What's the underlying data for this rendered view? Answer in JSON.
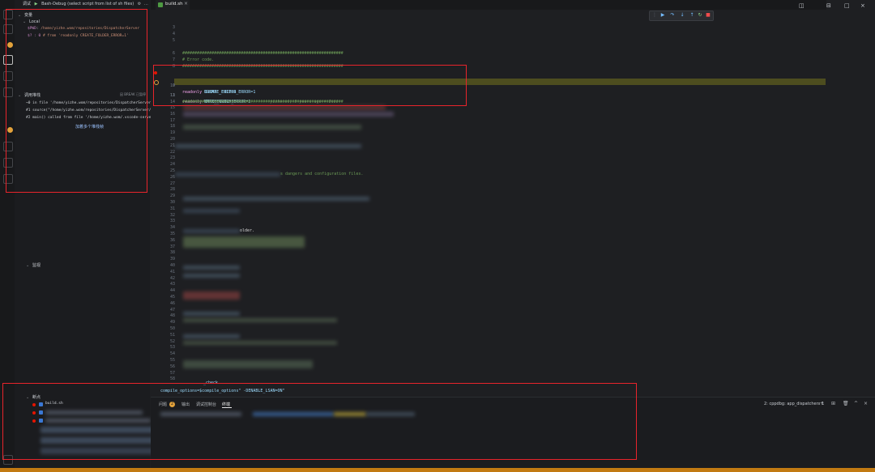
{
  "sidebar": {
    "debug_label": "调试",
    "launch_config": "Bash-Debug (select script from list of sh files)",
    "variables_header": "变量",
    "local_header": "Local",
    "variables": [
      {
        "name": "$PWD",
        "value": "/home/yizhe.wom/repositories/DispatcherServer"
      },
      {
        "name": "$? : 0",
        "value": "# from 'readonly CREATE_FOLDER_ERROR=1'"
      }
    ],
    "callstack_header": "调用堆栈",
    "callstack_status": "因 BREAK 已暂停",
    "frames": [
      "→0 in file '/home/yizhe.wom/repositories/DispatcherServer/build.sh'",
      "#1 source(\"/home/yizhe.wom/repositories/DispatcherServer/build.sh\")",
      "#2 main() called from file '/home/yizhe.wom/.vscode-server/...'"
    ],
    "annotation": "加着多个堆栈帧",
    "watch_header": "监视",
    "breakpoints_header": "断点",
    "breakpoint_first": "build.sh",
    "breakpoint_numbers": [
      "10",
      "18",
      "40",
      "41",
      "54"
    ]
  },
  "editor": {
    "tab_label": "build.sh",
    "tab_close": "×",
    "debug_toolbar": [
      "▶",
      "↷",
      "↓",
      "↑",
      "↻",
      "■"
    ],
    "lines": [
      {
        "n": "3",
        "html": ""
      },
      {
        "n": "4",
        "html": ""
      },
      {
        "n": "5",
        "html": ""
      },
      {
        "n": "6",
        "html": "##################################################################"
      },
      {
        "n": "7",
        "html": "# Error code."
      },
      {
        "n": "8",
        "html": "##################################################################"
      },
      {
        "n": "9",
        "kw": "readonly",
        "rest": "NORMAL_EXIT=0"
      },
      {
        "n": "10",
        "kw": "readonly",
        "rest": "CREATE_FOLDER_ERROR=1"
      },
      {
        "n": "11",
        "kw": "readonly",
        "rest": "CMAKE_BUILD_ERROR=2",
        "blame": "yizhe.wt, 3 years ago • Init"
      },
      {
        "n": "12",
        "kw": "readonly",
        "rest": "MAKE_ERROR=3"
      },
      {
        "n": "13",
        "html": ""
      },
      {
        "n": "14",
        "html": "##################################################################"
      }
    ],
    "other_line_numbers": [
      "15",
      "16",
      "17",
      "18",
      "19",
      "20",
      "21",
      "22",
      "23",
      "24",
      "25",
      "26",
      "27",
      "28",
      "29",
      "30",
      "31",
      "32",
      "33",
      "34",
      "35",
      "36",
      "37",
      "38",
      "39",
      "40",
      "41",
      "42",
      "43",
      "44",
      "45",
      "46",
      "47",
      "48",
      "49",
      "50",
      "51",
      "52",
      "53",
      "54",
      "55",
      "56",
      "57",
      "58"
    ],
    "fragment_1": "s dangers and configuration files.",
    "fragment_2": "older.",
    "fragment_3": "compile_options=$compile_options\" -DENABLE_LSAN=ON\"",
    "fragment_4": "_check"
  },
  "panel": {
    "tabs": [
      "问题",
      "输出",
      "调试控制台",
      "终端"
    ],
    "problems_count": "2",
    "terminal_select": "2: cppdbg: app_dispatcherx 1",
    "icons": [
      "+",
      "⊞",
      "🗑",
      "^",
      "×"
    ]
  },
  "window_controls": [
    "◫",
    "⊟",
    "□",
    "×"
  ]
}
